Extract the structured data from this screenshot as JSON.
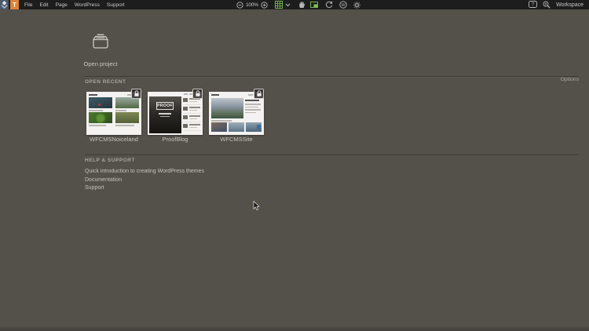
{
  "app": {
    "logo_letter": "T",
    "menus": [
      "File",
      "Edit",
      "Page",
      "WordPress",
      "Support"
    ],
    "zoom_level": "100%",
    "workspace_label": "Workspace"
  },
  "main": {
    "open_project_label": "Open project",
    "open_recent_heading": "OPEN RECENT",
    "options_label": "Options",
    "projects": [
      {
        "name": "WFCMSNoiceland"
      },
      {
        "name": "ProofBlog",
        "badge": "PROOF"
      },
      {
        "name": "WFCMSSite"
      }
    ],
    "help_heading": "HELP & SUPPORT",
    "help_links": [
      "Quick introduction to creating WordPress themes",
      "Documentation",
      "Support"
    ]
  },
  "colors": {
    "topbar": "#1d1d1d",
    "background": "#54514a",
    "accent_orange": "#e08138",
    "toolbar_green": "#7cc356",
    "logo_blue": "#49586a"
  }
}
